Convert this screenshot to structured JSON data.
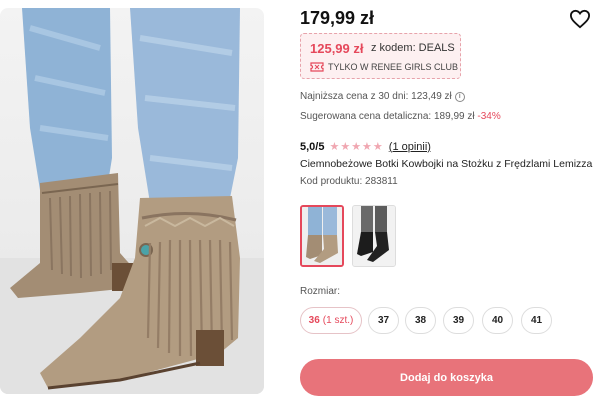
{
  "product": {
    "price": "179,99 zł",
    "deal": {
      "price": "125,99 zł",
      "code_text": "z kodem: DEALS",
      "club_text": "TYLKO W RENEE GIRLS CLUB"
    },
    "lowest_price_text": "Najniższa cena z 30 dni: 123,49 zł",
    "suggested_price_text": "Sugerowana cena detaliczna: 189,99 zł",
    "suggested_discount": "-34%",
    "rating_score": "5,0/5",
    "rating_stars": 5,
    "reviews_text": "(1 opinii)",
    "name": "Ciemnobeżowe Botki Kowbojki na Stożku z Frędzlami Lemizza",
    "code_text": "Kod produktu: 283811"
  },
  "variants": [
    {
      "color": "beige",
      "selected": true
    },
    {
      "color": "black",
      "selected": false
    }
  ],
  "sizes": {
    "label": "Rozmiar:",
    "items": [
      {
        "size": "36",
        "extra": "(1 szt.)",
        "selected": true
      },
      {
        "size": "37",
        "extra": "",
        "selected": false
      },
      {
        "size": "38",
        "extra": "",
        "selected": false
      },
      {
        "size": "39",
        "extra": "",
        "selected": false
      },
      {
        "size": "40",
        "extra": "",
        "selected": false
      },
      {
        "size": "41",
        "extra": "",
        "selected": false
      }
    ]
  },
  "cart_button_label": "Dodaj do koszyka",
  "icons": {
    "wishlist": "heart-outline-icon",
    "club": "ticket-icon",
    "info": "info-icon",
    "stars": "star-icon"
  },
  "colors": {
    "accent": "#e5485b",
    "button": "#e8737a",
    "stars": "#f0a7b1"
  }
}
